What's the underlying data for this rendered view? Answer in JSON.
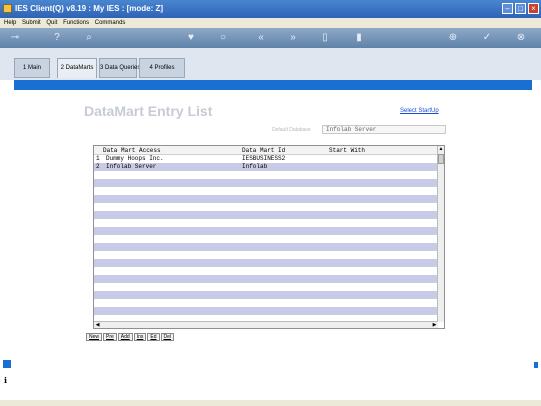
{
  "window": {
    "title": "IES Client(Q) v8.19 : My IES :      [mode: Z]"
  },
  "menu": [
    "Help",
    "Submit",
    "Quit",
    "Functions",
    "Commands"
  ],
  "toolbar_icons": [
    "key-icon",
    "help-icon",
    "search-icon",
    "heart-icon",
    "clock-icon",
    "back-icon",
    "forward-icon",
    "copy-icon",
    "window-icon",
    "add-icon",
    "check-icon",
    "close-icon"
  ],
  "tabs": [
    "1 Main",
    "2 DataMarts",
    "3 Data Queries",
    "4 Profiles"
  ],
  "page": {
    "heading": "DataMart Entry List",
    "select_startup": "Select StartUp",
    "default_db_label": "Default Database",
    "default_db_value": "Infolab Server"
  },
  "grid": {
    "headers": [
      "Data Mart Access",
      "Data Mart Id",
      "Start With"
    ],
    "rows": [
      {
        "num": "1",
        "access": "Dummy Hoops Inc.",
        "id": "IESBUSINESS2",
        "start": ""
      },
      {
        "num": "2",
        "access": "Infolab Server",
        "id": "Infolab",
        "start": ""
      }
    ]
  },
  "actions": [
    "New",
    "Pre",
    "Add",
    "Ins",
    "Ed",
    "Del"
  ],
  "colors": {
    "title_bar": "#2f62b6",
    "accent": "#1a6fd3",
    "row_alt": "#c9cbe6"
  }
}
